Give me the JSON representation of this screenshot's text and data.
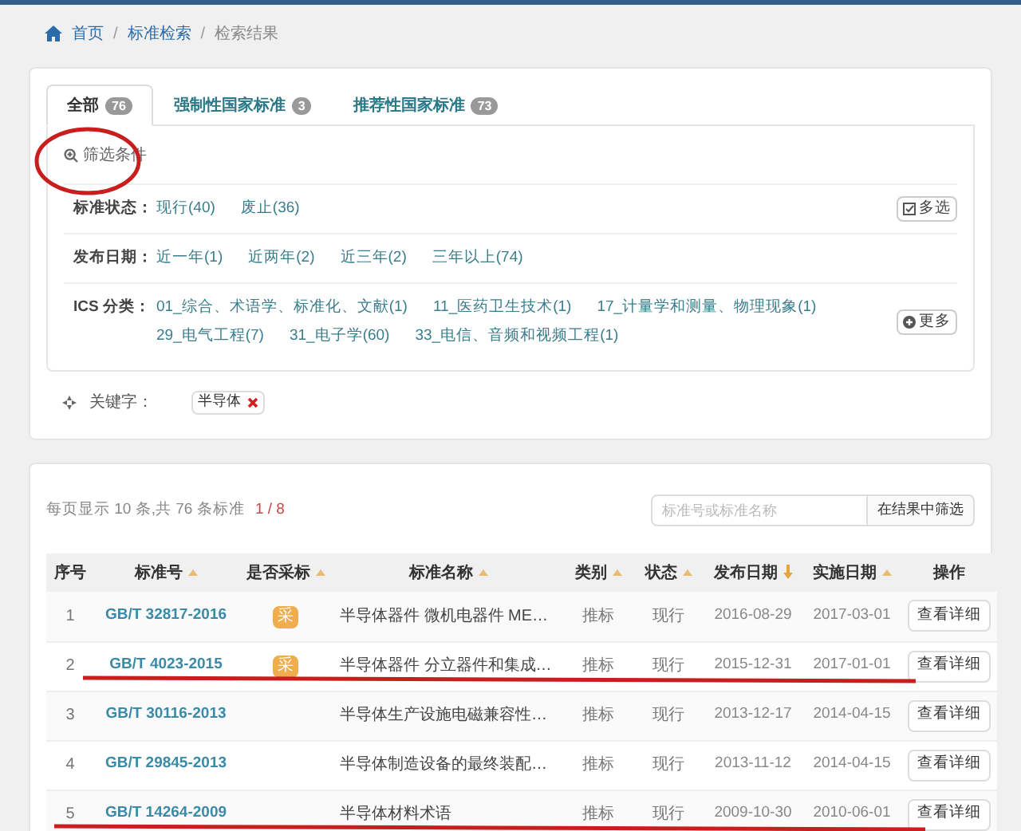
{
  "breadcrumb": {
    "separator": "/",
    "items": [
      "首页",
      "标准检索",
      "检索结果"
    ]
  },
  "tabs": [
    {
      "label": "全部",
      "count": "76",
      "selected": true
    },
    {
      "label": "强制性国家标准",
      "count": "3",
      "selected": false
    },
    {
      "label": "推荐性国家标准",
      "count": "73",
      "selected": false
    }
  ],
  "filter_title": "筛选条件",
  "filters": [
    {
      "label": "标准状态：",
      "options": [
        "现行(40)",
        "废止(36)"
      ],
      "action": {
        "kind": "multi",
        "label": "多选"
      }
    },
    {
      "label": "发布日期：",
      "options": [
        "近一年(1)",
        "近两年(2)",
        "近三年(2)",
        "三年以上(74)"
      ]
    },
    {
      "label": "ICS 分类：",
      "options": [
        "01_综合、术语学、标准化、文献(1)",
        "11_医药卫生技术(1)",
        "17_计量学和测量、物理现象(1)",
        "29_电气工程(7)",
        "31_电子学(60)",
        "33_电信、音频和视频工程(1)"
      ],
      "action": {
        "kind": "more",
        "label": "更多"
      }
    }
  ],
  "keyword": {
    "label": "关键字：",
    "tags": [
      "半导体"
    ]
  },
  "pager": {
    "summary": "每页显示 10 条,共 76 条标准",
    "page": "1 / 8"
  },
  "search": {
    "placeholder": "标准号或标准名称",
    "button": "在结果中筛选"
  },
  "table": {
    "columns": [
      {
        "label": "序号"
      },
      {
        "label": "标准号",
        "sort_active": false
      },
      {
        "label": "是否采标",
        "sort_active": false
      },
      {
        "label": "标准名称",
        "sort_active": false
      },
      {
        "label": "类别",
        "sort_active": false
      },
      {
        "label": "状态",
        "sort_active": false
      },
      {
        "label": "发布日期",
        "sort_active": true
      },
      {
        "label": "实施日期",
        "sort_active": false
      },
      {
        "label": "操作"
      }
    ],
    "rows": [
      {
        "no": "1",
        "code": "GB/T 32817-2016",
        "adopted": "采",
        "name": "半导体器件 微机电器件 ME…",
        "type": "推标",
        "status": "现行",
        "published": "2016-08-29",
        "effective": "2017-03-01",
        "action": "查看详细"
      },
      {
        "no": "2",
        "code": "GB/T 4023-2015",
        "adopted": "采",
        "name": "半导体器件 分立器件和集成…",
        "type": "推标",
        "status": "现行",
        "published": "2015-12-31",
        "effective": "2017-01-01",
        "action": "查看详细"
      },
      {
        "no": "3",
        "code": "GB/T 30116-2013",
        "name": "半导体生产设施电磁兼容性…",
        "type": "推标",
        "status": "现行",
        "published": "2013-12-17",
        "effective": "2014-04-15",
        "action": "查看详细"
      },
      {
        "no": "4",
        "code": "GB/T 29845-2013",
        "name": "半导体制造设备的最终装配…",
        "type": "推标",
        "status": "现行",
        "published": "2013-11-12",
        "effective": "2014-04-15",
        "action": "查看详细"
      },
      {
        "no": "5",
        "code": "GB/T 14264-2009",
        "name": "半导体材料术语",
        "type": "推标",
        "status": "现行",
        "published": "2009-10-30",
        "effective": "2010-06-01",
        "action": "查看详细"
      }
    ]
  },
  "annotations": [
    {
      "kind": "circle"
    },
    {
      "kind": "line"
    },
    {
      "kind": "line"
    }
  ]
}
